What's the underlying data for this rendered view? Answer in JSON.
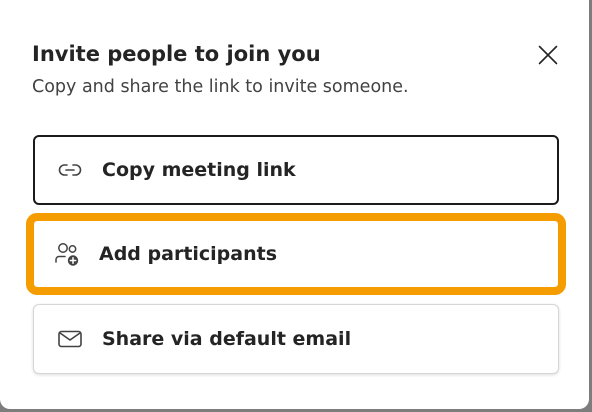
{
  "dialog": {
    "title": "Invite people to join you",
    "subtitle": "Copy and share the link to invite someone.",
    "close_icon": "close-icon",
    "options": [
      {
        "label": "Copy meeting link",
        "icon": "link-icon"
      },
      {
        "label": "Add participants",
        "icon": "add-participants-icon"
      },
      {
        "label": "Share via default email",
        "icon": "mail-icon"
      }
    ]
  },
  "colors": {
    "highlight": "#f59c00",
    "text": "#242424",
    "subtext": "#424242"
  }
}
